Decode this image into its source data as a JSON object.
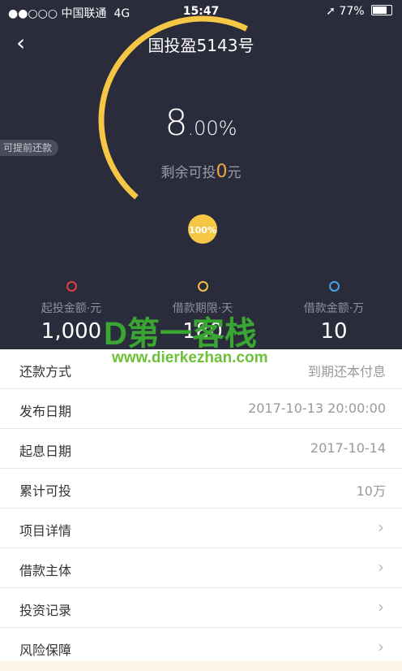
{
  "status_bar": {
    "carrier": "●●○○○ 中国联通",
    "network": "4G",
    "time": "15:47",
    "battery": "77%",
    "battery_level": 0.77
  },
  "header": {
    "back_icon": "chevron-left-icon",
    "title": "国投盈5143号"
  },
  "rate": {
    "integer": "8",
    "decimal": ".00%"
  },
  "remaining": {
    "label": "剩余可投",
    "value": "0",
    "unit": "元"
  },
  "progress": {
    "label": "100%",
    "value": 1.0
  },
  "prepay_tag": "可提前还款",
  "stats": [
    {
      "label": "起投金额·元",
      "value": "1,000",
      "color": "#e24040"
    },
    {
      "label": "借款期限·天",
      "value": "180",
      "color": "#f0c040"
    },
    {
      "label": "借款金额·万",
      "value": "10",
      "color": "#4aa0e8"
    }
  ],
  "watermark": {
    "logo": "D第一客栈",
    "url": "www.dierkezhan.com"
  },
  "details": [
    {
      "key": "还款方式",
      "value": "到期还本付息"
    },
    {
      "key": "发布日期",
      "value": "2017-10-13 20:00:00"
    },
    {
      "key": "起息日期",
      "value": "2017-10-14"
    },
    {
      "key": "累计可投",
      "value": "10万"
    }
  ],
  "links": [
    {
      "label": "项目详情"
    },
    {
      "label": "借款主体"
    },
    {
      "label": "投资记录"
    },
    {
      "label": "风险保障"
    }
  ],
  "colors": {
    "header_bg": "#2a2c3b",
    "arc": "#f6c744",
    "accent": "#f0a741"
  }
}
